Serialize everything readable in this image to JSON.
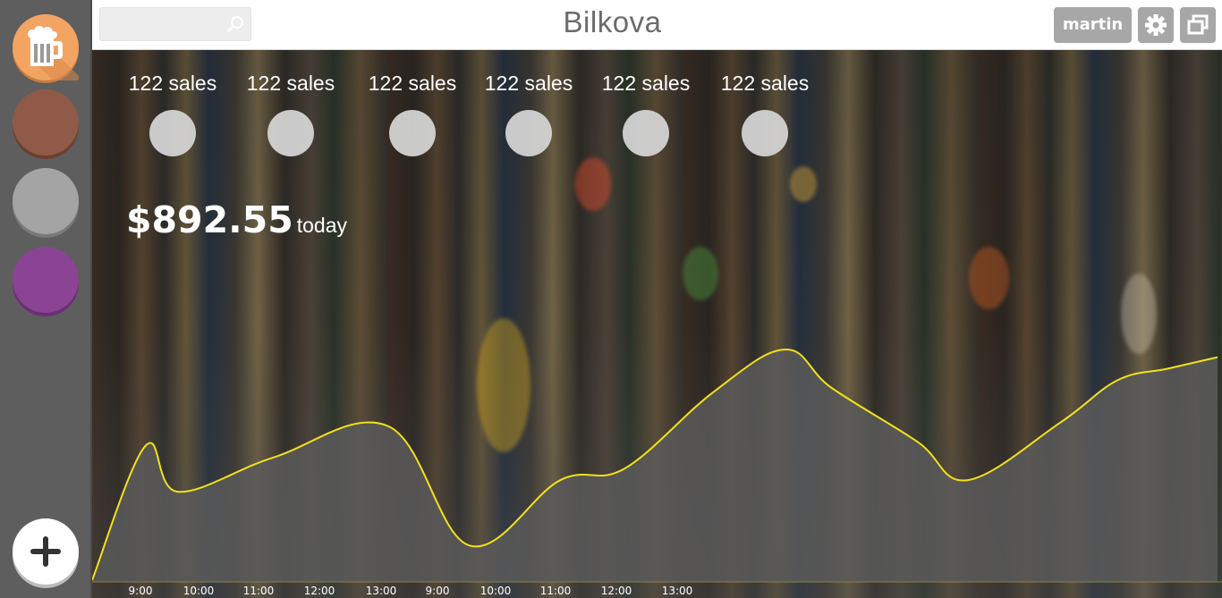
{
  "sidebar": {
    "items": [
      {
        "name": "beer",
        "color": "#f2a463",
        "icon": "beer-mug-icon"
      },
      {
        "name": "brown",
        "color": "#8f5a47"
      },
      {
        "name": "gray",
        "color": "#a4a4a4"
      },
      {
        "name": "purple",
        "color": "#8b4494"
      }
    ],
    "add_icon": "plus-icon"
  },
  "header": {
    "search_placeholder": "",
    "search_value": "",
    "title": "Bilkova",
    "user": "martin",
    "settings_icon": "gear-icon",
    "window_icon": "restore-window-icon"
  },
  "main": {
    "stats": [
      {
        "label": "122 sales"
      },
      {
        "label": "122 sales"
      },
      {
        "label": "122 sales"
      },
      {
        "label": "122 sales"
      },
      {
        "label": "122 sales"
      },
      {
        "label": "122 sales"
      }
    ],
    "total_amount": "$892.55",
    "total_suffix": "today"
  },
  "chart_data": {
    "type": "area",
    "categories": [
      "9:00",
      "10:00",
      "11:00",
      "12:00",
      "13:00",
      "9:00",
      "10:00",
      "11:00",
      "12:00",
      "13:00"
    ],
    "series": [
      {
        "values": [
          0,
          35,
          23,
          32,
          40,
          9,
          26,
          29,
          49,
          60,
          50,
          36,
          26,
          41,
          52,
          55,
          58
        ]
      }
    ],
    "line_color": "#f2e11b",
    "fill_color": "#5a5a5a"
  }
}
